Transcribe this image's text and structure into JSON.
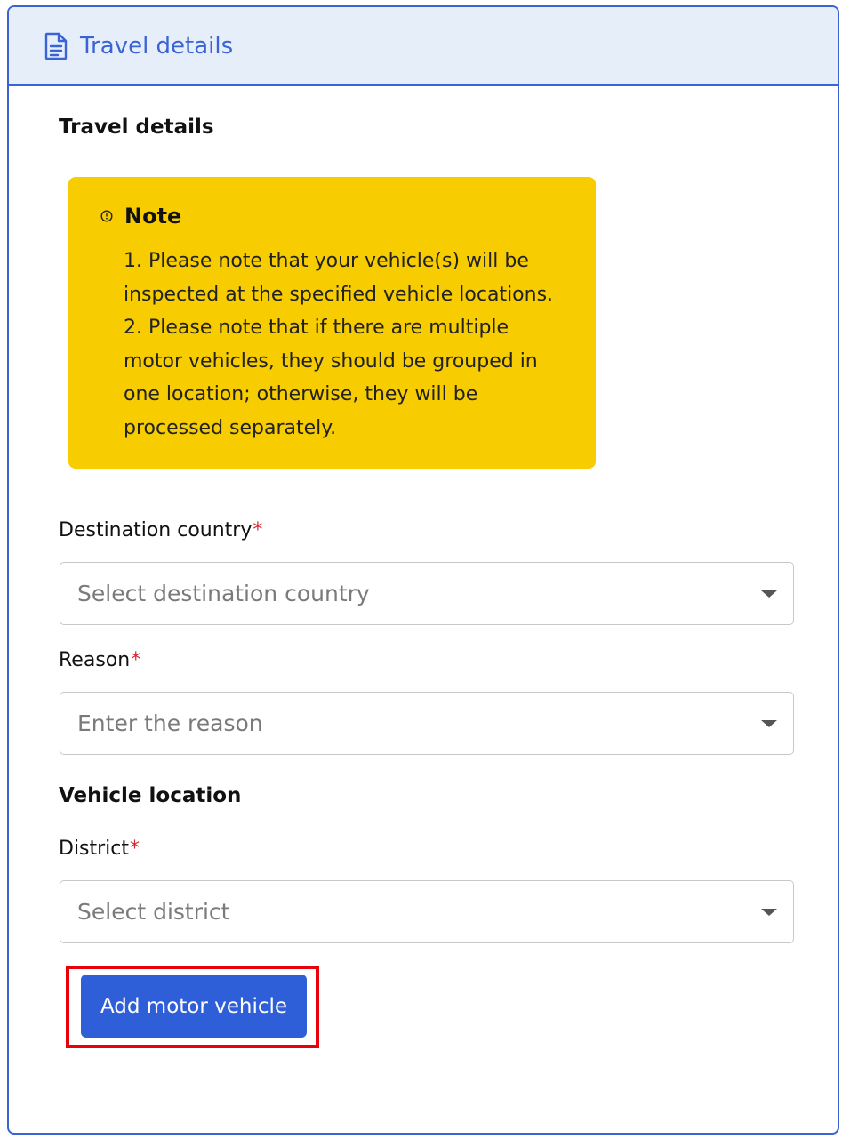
{
  "header": {
    "title": "Travel details",
    "icon": "document-icon"
  },
  "form": {
    "section_title": "Travel details",
    "note": {
      "title": "Note",
      "lines": [
        "1. Please note that your vehicle(s) will be",
        "inspected at the specified vehicle locations.",
        "2. Please note that if there are multiple",
        "motor vehicles, they should be grouped in",
        "one location; otherwise, they will be",
        "processed separately."
      ]
    },
    "destination": {
      "label": "Destination country",
      "required_mark": "*",
      "placeholder": "Select destination country"
    },
    "reason": {
      "label": "Reason",
      "required_mark": "*",
      "placeholder": "Enter the reason"
    },
    "vehicle_location_title": "Vehicle location",
    "district": {
      "label": "District",
      "required_mark": "*",
      "placeholder": "Select district"
    },
    "add_button_label": "Add motor vehicle"
  },
  "colors": {
    "accent": "#3a63d6",
    "note_bg": "#f7cc00",
    "required": "#d9232e",
    "highlight": "#e8000b",
    "button": "#2f5fd8"
  }
}
